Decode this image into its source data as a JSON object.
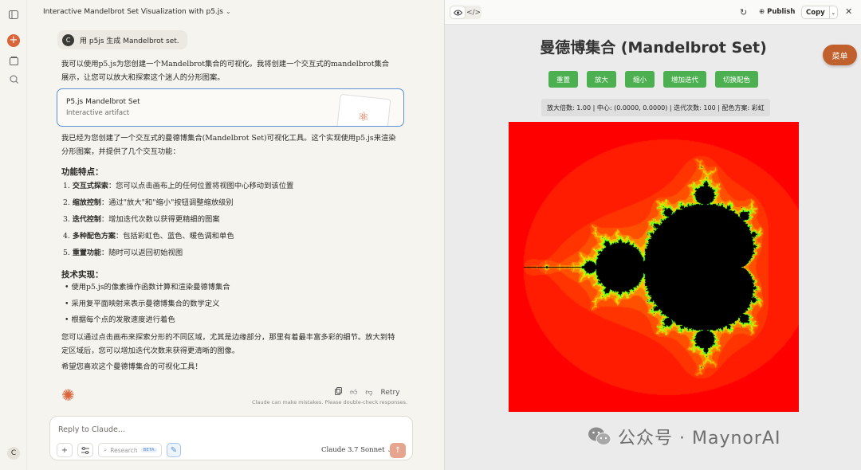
{
  "chat": {
    "title": "Interactive Mandelbrot Set Visualization with p5.js",
    "user_avatar": "C",
    "user_message": "用 p5js 生成 Mandelbrot set.",
    "intro": "我可以使用p5.js为您创建一个Mandelbrot集合的可视化。我将创建一个交互式的mandelbrot集合展示，让您可以放大和探索这个迷人的分形图案。",
    "artifact": {
      "title": "P5.js Mandelbrot Set",
      "subtitle": "Interactive artifact"
    },
    "summary": "我已经为您创建了一个交互式的曼德博集合(Mandelbrot Set)可视化工具。这个实现使用p5.js来渲染分形图案，并提供了几个交互功能：",
    "features_heading": "功能特点：",
    "features": [
      {
        "n": "1.",
        "label": "交互式探索",
        "text": "：您可以点击画布上的任何位置将视图中心移动到该位置"
      },
      {
        "n": "2.",
        "label": "缩放控制",
        "text": "：通过\"放大\"和\"缩小\"按钮调整缩放级别"
      },
      {
        "n": "3.",
        "label": "迭代控制",
        "text": "：增加迭代次数以获得更精细的图案"
      },
      {
        "n": "4.",
        "label": "多种配色方案",
        "text": "：包括彩虹色、蓝色、暖色调和单色"
      },
      {
        "n": "5.",
        "label": "重置功能",
        "text": "：随时可以返回初始视图"
      }
    ],
    "tech_heading": "技术实现：",
    "tech": [
      "使用p5.js的像素操作函数计算和渲染曼德博集合",
      "采用复平面映射来表示曼德博集合的数学定义",
      "根据每个点的发散速度进行着色"
    ],
    "closing1": "您可以通过点击画布来探索分形的不同区域，尤其是边缘部分，那里有着最丰富多彩的细节。放大到特定区域后，您可以增加迭代次数来获得更清晰的图像。",
    "closing2": "希望您喜欢这个曼德博集合的可视化工具！",
    "retry": "Retry",
    "disclaimer": "Claude can make mistakes. Please double-check responses.",
    "composer": {
      "placeholder": "Reply to Claude...",
      "research": "Research",
      "beta": "BETA",
      "model": "Claude 3.7 Sonnet"
    }
  },
  "rail": {
    "avatar": "C"
  },
  "pane": {
    "publish": "Publish",
    "copy": "Copy",
    "app": {
      "title": "曼德博集合 (Mandelbrot Set)",
      "menu": "菜单",
      "buttons": [
        "重置",
        "放大",
        "缩小",
        "增加迭代",
        "切换配色"
      ],
      "info": "放大倍数: 1.00 | 中心: (0.0000, 0.0000) | 迭代次数: 100 | 配色方案: 彩虹"
    }
  },
  "watermark": "公众号 · MaynorAI",
  "colors": {
    "accent": "#d9643a",
    "green_button": "#4caf50",
    "menu_button": "#c0602c",
    "link_blue": "#5b8fd6"
  }
}
